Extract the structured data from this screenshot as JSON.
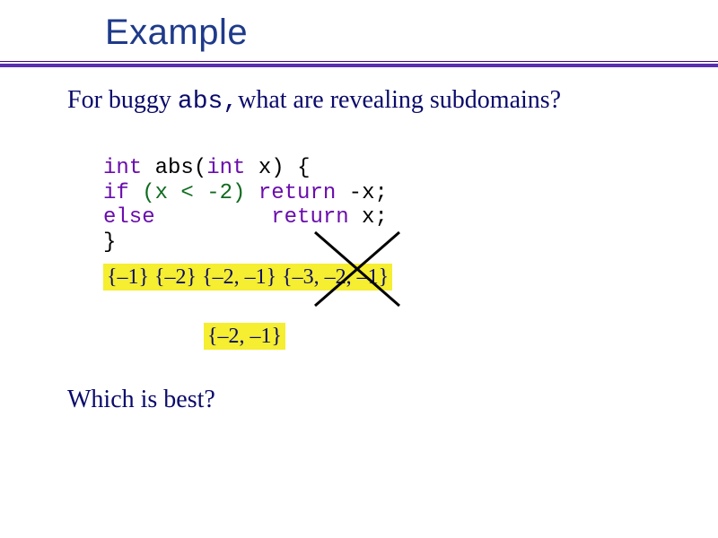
{
  "title": "Example",
  "question": {
    "pre": "For buggy ",
    "code": "abs,",
    "post": "what are revealing subdomains?"
  },
  "code": {
    "l1": {
      "kw": "int",
      "rest": " abs(",
      "kw2": "int",
      "rest2": " x) {"
    },
    "l2": {
      "kw": "if",
      "sp": " ",
      "cond": "(x < -2)",
      "sp2": " ",
      "kw2": "return",
      "rest": " -x;"
    },
    "l3": {
      "kw": "else",
      "pad": "         ",
      "kw2": "return",
      "rest": " x;"
    },
    "l4": "}"
  },
  "subdomains_line": "{–1} {–2} {–2, –1}  {–3, –2, –1}",
  "subdomains_best": "{–2, –1}",
  "question2": "Which is best?",
  "chart_data": {
    "type": "table",
    "title": "Revealing subdomains for buggy abs",
    "candidates": [
      {
        "set": [
          -1
        ],
        "crossed_out": false
      },
      {
        "set": [
          -2
        ],
        "crossed_out": false
      },
      {
        "set": [
          -2,
          -1
        ],
        "crossed_out": false
      },
      {
        "set": [
          -3,
          -2,
          -1
        ],
        "crossed_out": true
      }
    ],
    "best": [
      -2,
      -1
    ]
  }
}
